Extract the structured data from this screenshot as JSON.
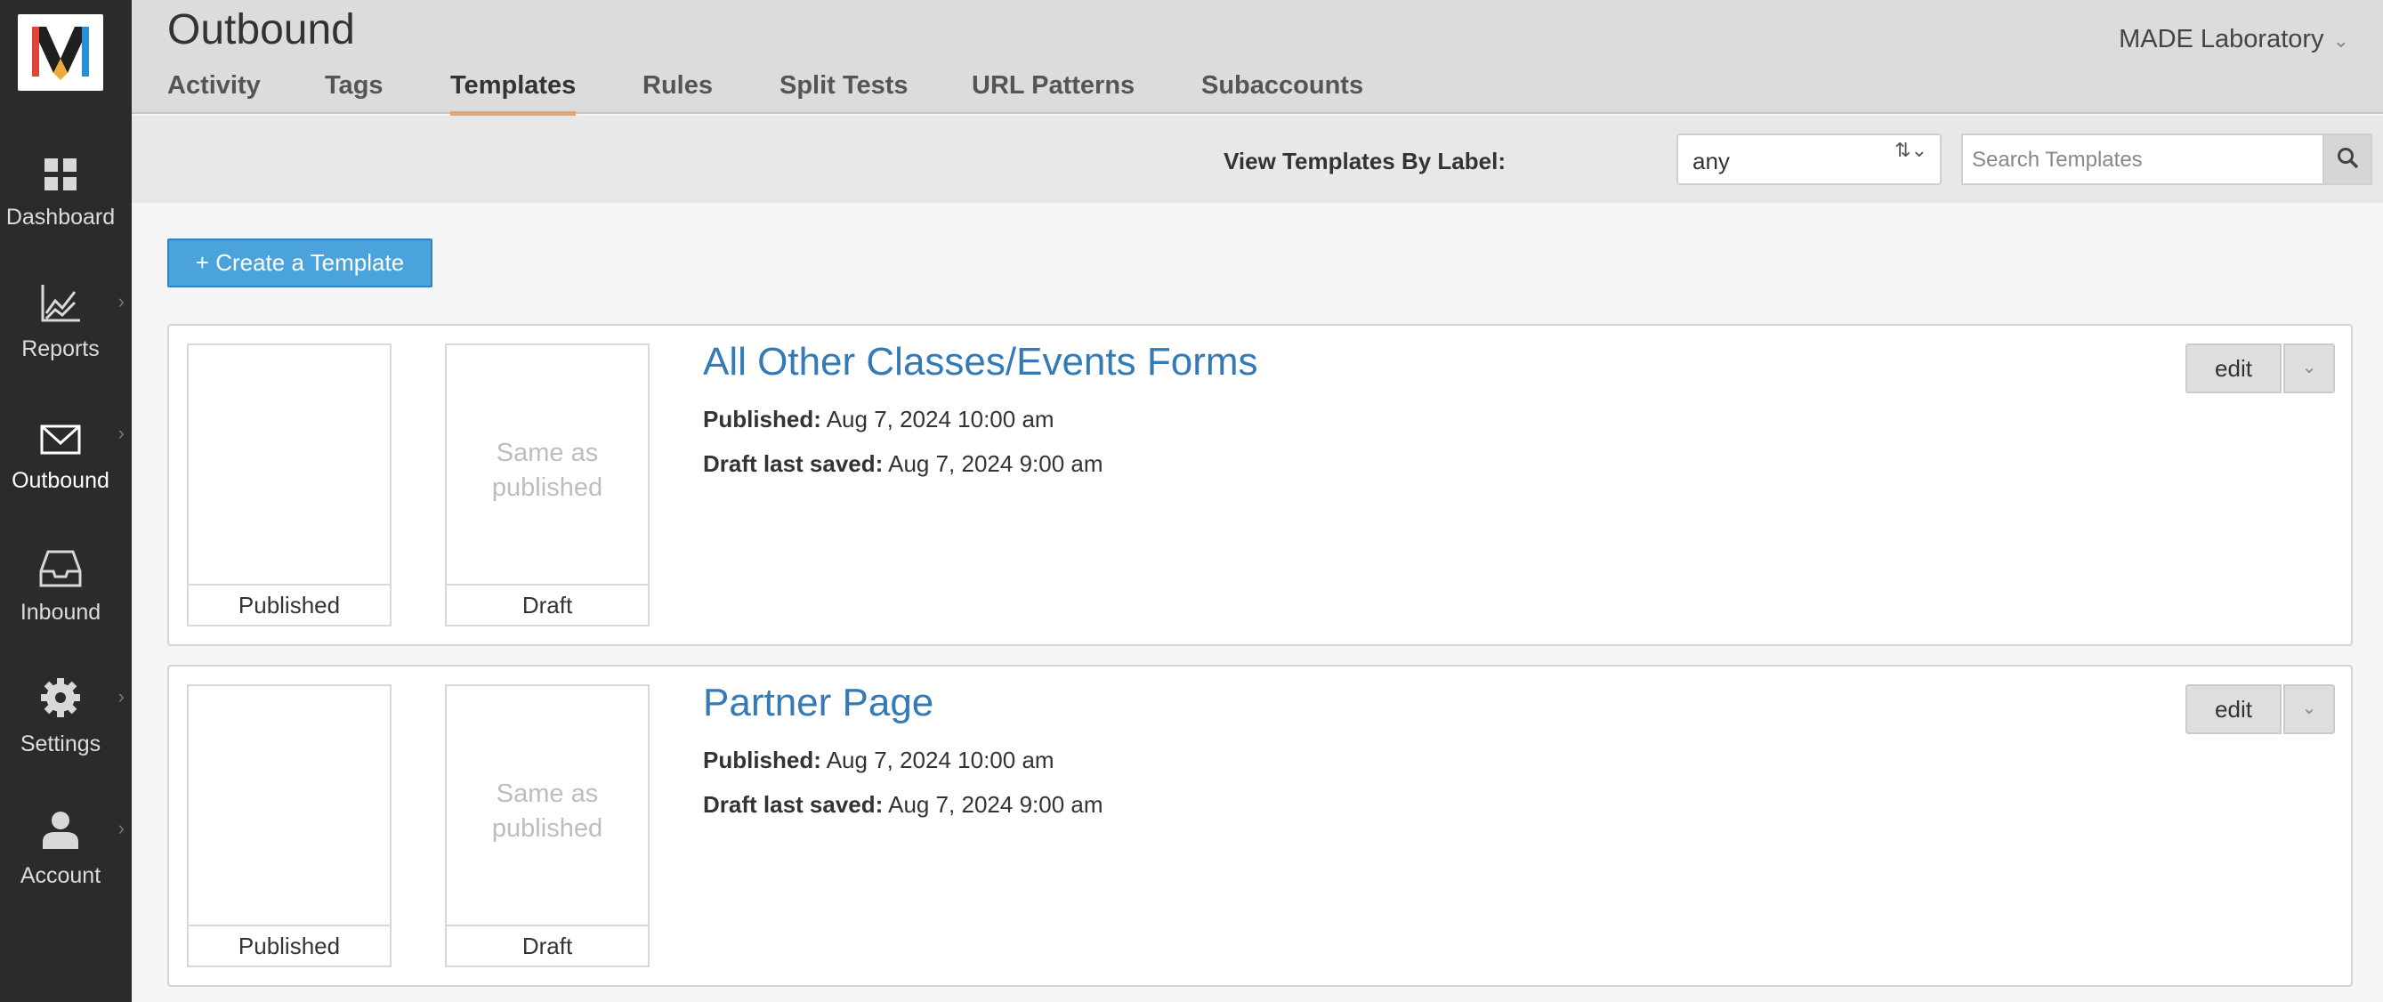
{
  "header": {
    "title": "Outbound",
    "org_name": "MADE Laboratory",
    "tabs": [
      {
        "label": "Activity"
      },
      {
        "label": "Tags"
      },
      {
        "label": "Templates"
      },
      {
        "label": "Rules"
      },
      {
        "label": "Split Tests"
      },
      {
        "label": "URL Patterns"
      },
      {
        "label": "Subaccounts"
      }
    ],
    "active_tab": "Templates"
  },
  "sidebar": {
    "items": [
      {
        "label": "Dashboard",
        "icon": "dashboard-icon"
      },
      {
        "label": "Reports",
        "icon": "reports-icon"
      },
      {
        "label": "Outbound",
        "icon": "envelope-icon"
      },
      {
        "label": "Inbound",
        "icon": "inbox-icon"
      },
      {
        "label": "Settings",
        "icon": "gear-icon"
      },
      {
        "label": "Account",
        "icon": "user-icon"
      }
    ]
  },
  "toolbar": {
    "filter_label": "View Templates By Label:",
    "filter_value": "any",
    "search_placeholder": "Search Templates"
  },
  "actions": {
    "create_label": "+ Create a Template"
  },
  "templates": [
    {
      "name": "All Other Classes/Events Forms",
      "published_label": "Published:",
      "published_value": "Aug 7, 2024 10:00 am",
      "draft_label": "Draft last saved:",
      "draft_value": "Aug 7, 2024 9:00 am",
      "thumb_published_caption": "Published",
      "thumb_draft_caption": "Draft",
      "thumb_draft_placeholder": "Same as published",
      "edit_label": "edit"
    },
    {
      "name": "Partner Page",
      "published_label": "Published:",
      "published_value": "Aug 7, 2024 10:00 am",
      "draft_label": "Draft last saved:",
      "draft_value": "Aug 7, 2024 9:00 am",
      "thumb_published_caption": "Published",
      "thumb_draft_caption": "Draft",
      "thumb_draft_placeholder": "Same as published",
      "edit_label": "edit"
    }
  ],
  "colors": {
    "accent_tab": "#e8a36d",
    "primary_button": "#4aa3da",
    "link": "#337ab7",
    "sidebar_bg": "#2b2b2b"
  }
}
